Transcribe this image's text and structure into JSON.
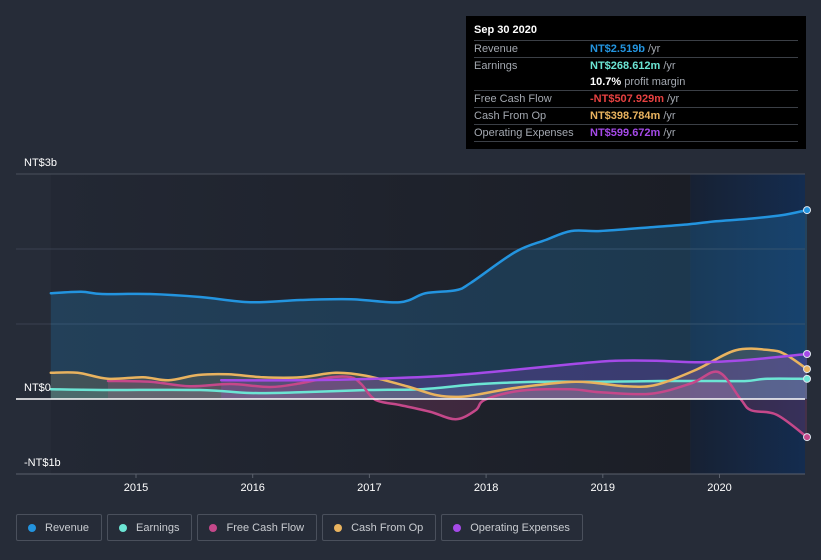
{
  "tooltip": {
    "date": "Sep 30 2020",
    "rows": [
      {
        "label": "Revenue",
        "value": "NT$2.519b",
        "unit": "/yr",
        "color": "#2394df"
      },
      {
        "label": "Earnings",
        "value": "NT$268.612m",
        "unit": "/yr",
        "color": "#6ce5d4"
      },
      {
        "label": "Free Cash Flow",
        "value": "-NT$507.929m",
        "unit": "/yr",
        "color": "#e64141"
      },
      {
        "label": "Cash From Op",
        "value": "NT$398.784m",
        "unit": "/yr",
        "color": "#e9b35f"
      },
      {
        "label": "Operating Expenses",
        "value": "NT$599.672m",
        "unit": "/yr",
        "color": "#a54ae8"
      }
    ],
    "profit_margin": {
      "value": "10.7%",
      "label": "profit margin"
    }
  },
  "legend": [
    {
      "label": "Revenue",
      "color": "#2394df"
    },
    {
      "label": "Earnings",
      "color": "#6ce5d4"
    },
    {
      "label": "Free Cash Flow",
      "color": "#c5488a"
    },
    {
      "label": "Cash From Op",
      "color": "#e9b35f"
    },
    {
      "label": "Operating Expenses",
      "color": "#a54ae8"
    }
  ],
  "chart_data": {
    "type": "line",
    "title": "",
    "xlabel": "",
    "ylabel": "",
    "ylim": [
      -1,
      3
    ],
    "y_unit": "NT$ billions",
    "y_ticks": [
      {
        "value": 3,
        "label": "NT$3b"
      },
      {
        "value": 0,
        "label": "NT$0"
      },
      {
        "value": -1,
        "label": "-NT$1b"
      }
    ],
    "x_range": [
      2014.0,
      2020.75
    ],
    "x_ticks": [
      {
        "value": 2015,
        "label": "2015"
      },
      {
        "value": 2016,
        "label": "2016"
      },
      {
        "value": 2017,
        "label": "2017"
      },
      {
        "value": 2018,
        "label": "2018"
      },
      {
        "value": 2019,
        "label": "2019"
      },
      {
        "value": 2020,
        "label": "2020"
      }
    ],
    "highlight_from": 2019.75,
    "grid": true,
    "legend_position": "bottom",
    "series": [
      {
        "name": "Revenue",
        "color": "#2394df",
        "fill": true,
        "points": [
          [
            2014.27,
            1.41
          ],
          [
            2014.53,
            1.43
          ],
          [
            2014.71,
            1.4
          ],
          [
            2015.12,
            1.4
          ],
          [
            2015.55,
            1.36
          ],
          [
            2015.98,
            1.29
          ],
          [
            2016.41,
            1.32
          ],
          [
            2016.84,
            1.33
          ],
          [
            2017.26,
            1.29
          ],
          [
            2017.48,
            1.41
          ],
          [
            2017.74,
            1.45
          ],
          [
            2017.87,
            1.55
          ],
          [
            2018.25,
            1.96
          ],
          [
            2018.51,
            2.12
          ],
          [
            2018.73,
            2.24
          ],
          [
            2018.98,
            2.24
          ],
          [
            2019.41,
            2.29
          ],
          [
            2019.74,
            2.33
          ],
          [
            2019.97,
            2.37
          ],
          [
            2020.23,
            2.4
          ],
          [
            2020.53,
            2.45
          ],
          [
            2020.75,
            2.519
          ]
        ]
      },
      {
        "name": "Earnings",
        "color": "#6ce5d4",
        "fill": true,
        "points": [
          [
            2014.27,
            0.13
          ],
          [
            2014.71,
            0.12
          ],
          [
            2015.55,
            0.12
          ],
          [
            2015.98,
            0.08
          ],
          [
            2016.41,
            0.09
          ],
          [
            2016.98,
            0.12
          ],
          [
            2017.44,
            0.13
          ],
          [
            2017.95,
            0.2
          ],
          [
            2018.46,
            0.23
          ],
          [
            2018.98,
            0.23
          ],
          [
            2019.5,
            0.24
          ],
          [
            2019.97,
            0.24
          ],
          [
            2020.23,
            0.24
          ],
          [
            2020.41,
            0.27
          ],
          [
            2020.75,
            0.269
          ]
        ]
      },
      {
        "name": "Free Cash Flow",
        "color": "#c5488a",
        "fill": true,
        "points": [
          [
            2014.76,
            0.24
          ],
          [
            2015.12,
            0.23
          ],
          [
            2015.46,
            0.17
          ],
          [
            2015.81,
            0.2
          ],
          [
            2016.15,
            0.16
          ],
          [
            2016.41,
            0.21
          ],
          [
            2016.67,
            0.29
          ],
          [
            2016.84,
            0.29
          ],
          [
            2016.93,
            0.2
          ],
          [
            2017.05,
            -0.01
          ],
          [
            2017.26,
            -0.08
          ],
          [
            2017.52,
            -0.17
          ],
          [
            2017.74,
            -0.27
          ],
          [
            2017.91,
            -0.15
          ],
          [
            2017.99,
            -0.01
          ],
          [
            2018.29,
            0.11
          ],
          [
            2018.72,
            0.13
          ],
          [
            2018.98,
            0.09
          ],
          [
            2019.41,
            0.07
          ],
          [
            2019.76,
            0.21
          ],
          [
            2019.99,
            0.36
          ],
          [
            2020.18,
            0.0
          ],
          [
            2020.27,
            -0.15
          ],
          [
            2020.49,
            -0.21
          ],
          [
            2020.75,
            -0.508
          ]
        ]
      },
      {
        "name": "Cash From Op",
        "color": "#e9b35f",
        "fill": true,
        "points": [
          [
            2014.27,
            0.35
          ],
          [
            2014.5,
            0.35
          ],
          [
            2014.76,
            0.27
          ],
          [
            2015.06,
            0.29
          ],
          [
            2015.28,
            0.25
          ],
          [
            2015.53,
            0.32
          ],
          [
            2015.79,
            0.33
          ],
          [
            2016.09,
            0.29
          ],
          [
            2016.41,
            0.29
          ],
          [
            2016.71,
            0.35
          ],
          [
            2016.97,
            0.31
          ],
          [
            2017.32,
            0.17
          ],
          [
            2017.58,
            0.05
          ],
          [
            2017.79,
            0.03
          ],
          [
            2018.0,
            0.08
          ],
          [
            2018.26,
            0.15
          ],
          [
            2018.77,
            0.23
          ],
          [
            2019.2,
            0.17
          ],
          [
            2019.46,
            0.19
          ],
          [
            2019.8,
            0.39
          ],
          [
            2020.14,
            0.65
          ],
          [
            2020.44,
            0.65
          ],
          [
            2020.57,
            0.59
          ],
          [
            2020.75,
            0.399
          ]
        ]
      },
      {
        "name": "Operating Expenses",
        "color": "#a54ae8",
        "fill": true,
        "points": [
          [
            2015.73,
            0.25
          ],
          [
            2016.41,
            0.25
          ],
          [
            2017.05,
            0.27
          ],
          [
            2017.65,
            0.31
          ],
          [
            2018.25,
            0.39
          ],
          [
            2018.77,
            0.47
          ],
          [
            2019.11,
            0.51
          ],
          [
            2019.46,
            0.51
          ],
          [
            2019.84,
            0.49
          ],
          [
            2020.23,
            0.52
          ],
          [
            2020.75,
            0.6
          ]
        ]
      }
    ]
  }
}
